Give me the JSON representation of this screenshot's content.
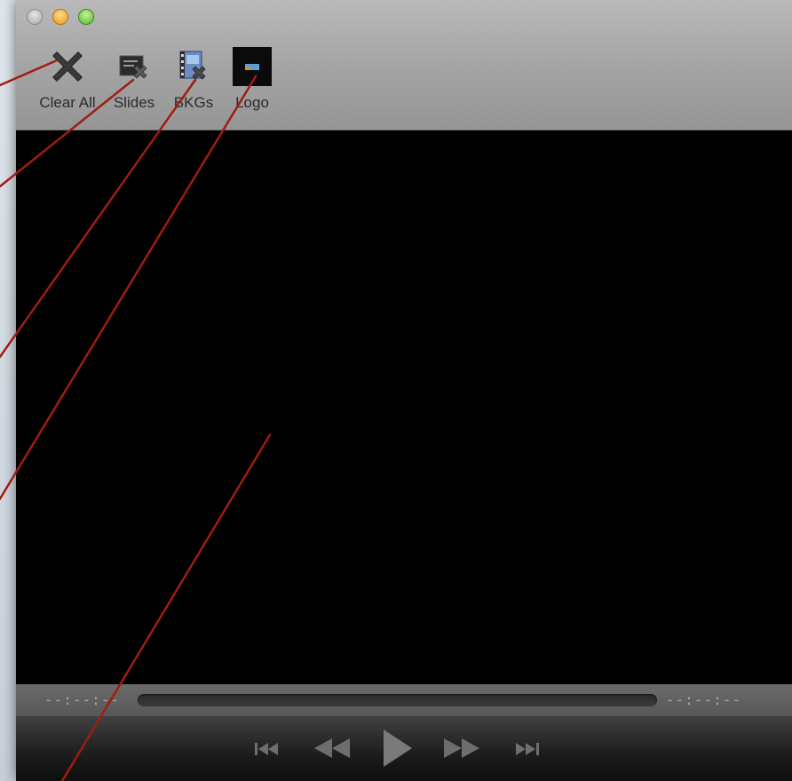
{
  "window": {
    "traffic_lights": [
      "close",
      "minimize",
      "zoom"
    ]
  },
  "toolbar": {
    "items": [
      {
        "label": "Clear All",
        "icon": "clear-all-x-icon"
      },
      {
        "label": "Slides",
        "icon": "slides-clear-icon"
      },
      {
        "label": "BKGs",
        "icon": "backgrounds-clear-icon"
      },
      {
        "label": "Logo",
        "icon": "logo-icon"
      }
    ]
  },
  "player": {
    "time_elapsed": "--:--:--",
    "time_remaining": "--:--:--",
    "controls": [
      "skip-to-start",
      "rewind",
      "play",
      "fast-forward",
      "skip-to-end"
    ]
  },
  "colors": {
    "callout_line": "#a01c10",
    "toolbar_bg": "#a9a9a9",
    "viewer_bg": "#000000"
  }
}
